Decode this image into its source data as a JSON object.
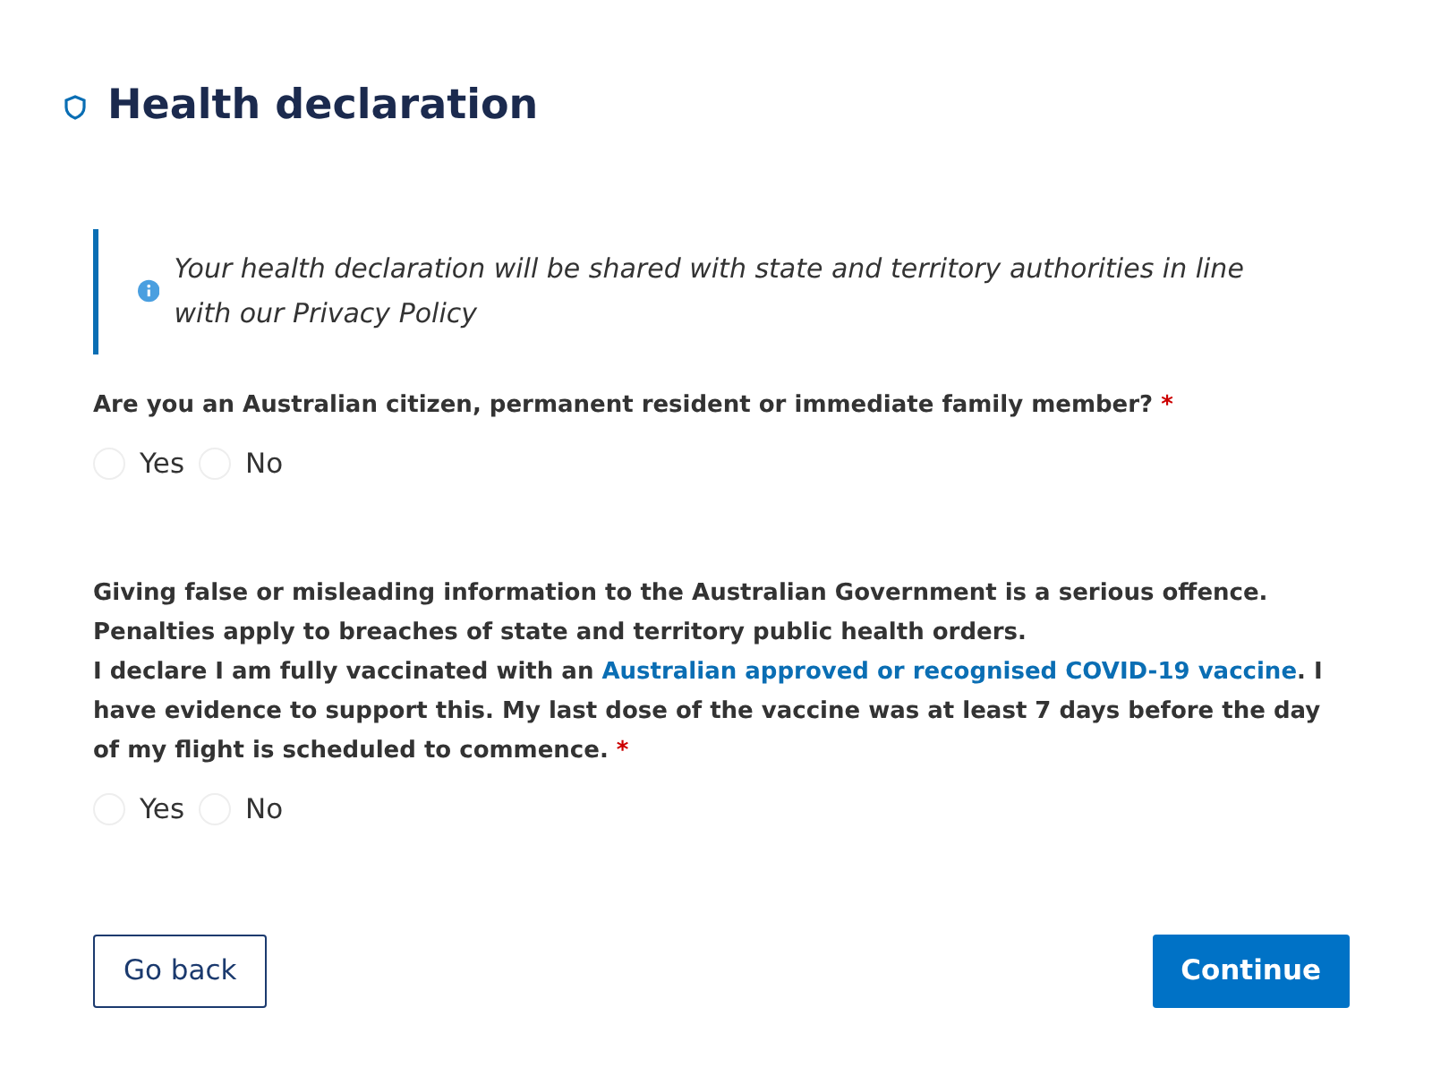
{
  "heading": "Health declaration",
  "notice": "Your health declaration will be shared with state and territory authorities in line with our Privacy Policy",
  "questions": [
    {
      "paragraphs": [
        [
          {
            "kind": "text",
            "text": "Are you an Australian citizen, permanent resident or immediate family member?"
          }
        ]
      ],
      "required_mark": "*",
      "options": [
        {
          "label": "Yes",
          "selected": false
        },
        {
          "label": "No",
          "selected": false
        }
      ]
    },
    {
      "paragraphs": [
        [
          {
            "kind": "text",
            "text": "Giving false or misleading information to the Australian Government is a serious offence. Penalties apply to breaches of state and territory public health orders."
          }
        ],
        [
          {
            "kind": "text",
            "text": "I declare I am fully vaccinated with an "
          },
          {
            "kind": "link",
            "text": "Australian approved or recognised COVID-19 vaccine"
          },
          {
            "kind": "text",
            "text": ". I have evidence to support this. My last dose of the vaccine was at least 7 days before the day of my flight is scheduled to commence."
          }
        ]
      ],
      "required_mark": "*",
      "options": [
        {
          "label": "Yes",
          "selected": false
        },
        {
          "label": "No",
          "selected": false
        }
      ]
    }
  ],
  "buttons": {
    "back": "Go back",
    "continue": "Continue"
  }
}
